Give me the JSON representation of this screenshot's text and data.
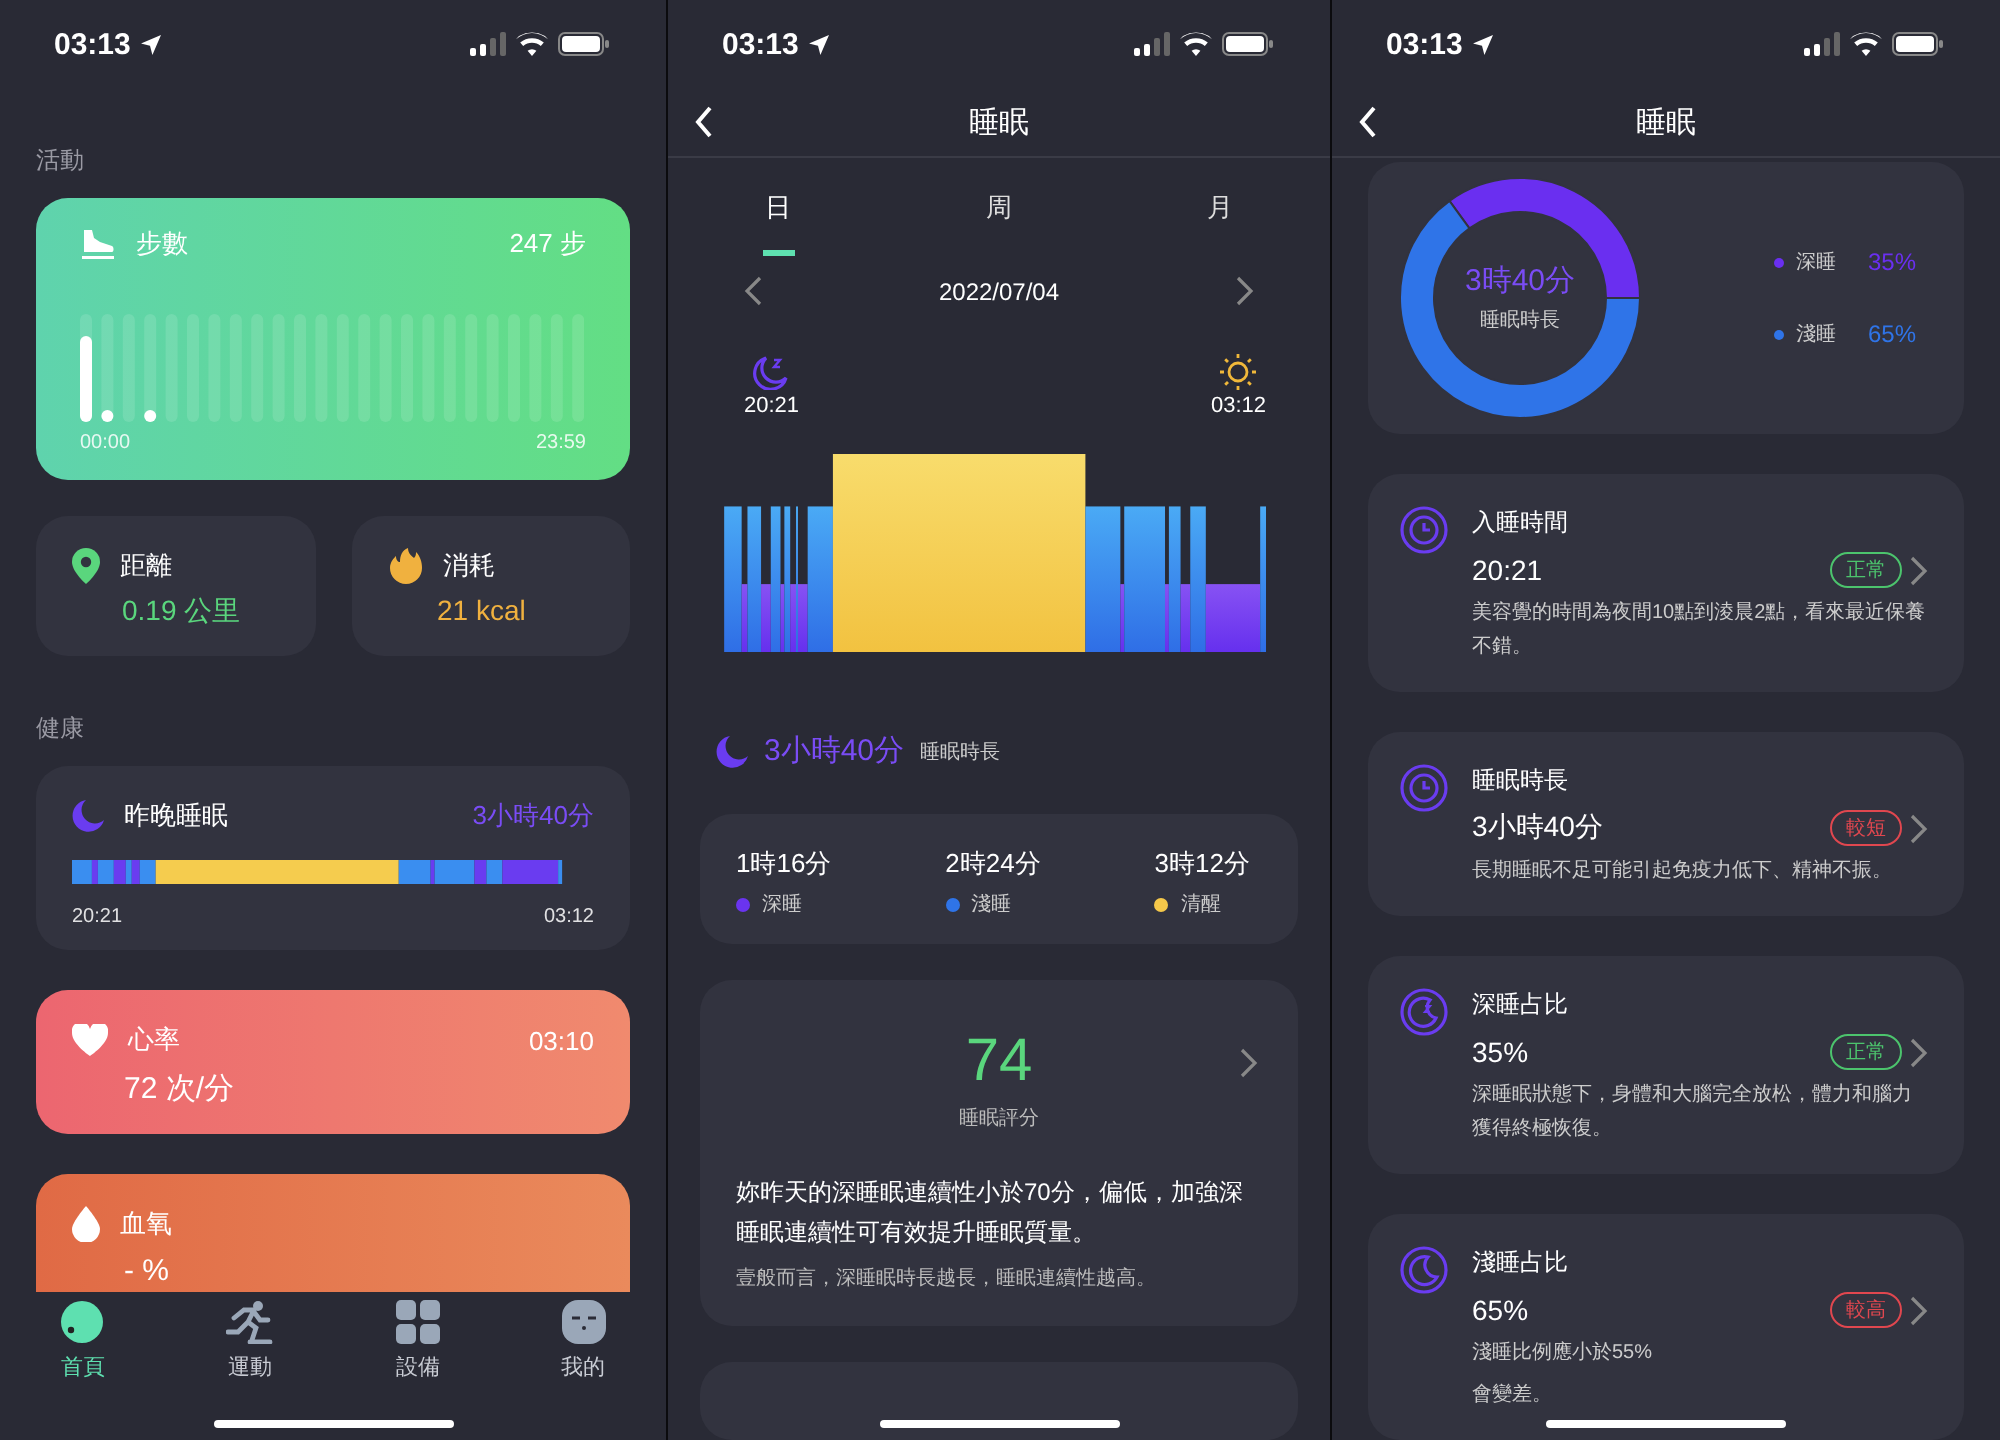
{
  "home": {
    "status_time": "03:13",
    "section_activity": "活動",
    "steps": {
      "label": "步數",
      "value": "247 步",
      "start": "00:00",
      "end": "23:59"
    },
    "stats": [
      {
        "kind": "distance",
        "label": "距離",
        "value": "0.19 公里"
      },
      {
        "kind": "calories",
        "label": "消耗",
        "value": "21 kcal"
      }
    ],
    "section_health": "健康",
    "sleep": {
      "label": "昨晚睡眠",
      "value": "3小時40分",
      "start": "20:21",
      "end": "03:12"
    },
    "vitals": [
      {
        "kind": "heart",
        "label": "心率",
        "value": "72 次/分",
        "time": "03:10"
      },
      {
        "kind": "oxygen",
        "label": "血氧",
        "value": "- %"
      }
    ],
    "tab_bar": [
      {
        "kind": "home",
        "label": "首頁",
        "selected": true
      },
      {
        "kind": "workout",
        "label": "運動",
        "selected": false
      },
      {
        "kind": "devices",
        "label": "設備",
        "selected": false
      },
      {
        "kind": "profile",
        "label": "我的",
        "selected": false
      }
    ]
  },
  "sleep_day": {
    "status_time": "03:13",
    "title": "睡眠",
    "tabs": [
      {
        "label": "日",
        "selected": true
      },
      {
        "label": "周",
        "selected": false
      },
      {
        "label": "月",
        "selected": false
      }
    ],
    "date": "2022/07/04",
    "sleep_time": "20:21",
    "wake_time": "03:12",
    "total": "3小時40分",
    "total_label": "睡眠時長",
    "stages": [
      {
        "value": "1時16分",
        "label": "深睡",
        "color": "#6a34f0"
      },
      {
        "value": "2時24分",
        "label": "淺睡",
        "color": "#2f74e8"
      },
      {
        "value": "3時12分",
        "label": "清醒",
        "color": "#f5c84a"
      }
    ],
    "score": {
      "value": "74",
      "label": "睡眠評分",
      "text": "妳昨天的深睡眠連續性小於70分，偏低，加強深睡眠連續性可有效提升睡眠質量。",
      "note": "壹般而言，深睡眠時長越長，睡眠連續性越高。"
    }
  },
  "sleep_detail": {
    "status_time": "03:13",
    "title": "睡眠",
    "center_value": "3時40分",
    "center_label": "睡眠時長",
    "chart_data": {
      "type": "donut",
      "categories": [
        "深睡",
        "淺睡"
      ],
      "values": [
        35,
        65
      ],
      "value_labels": [
        "35%",
        "65%"
      ],
      "colors": [
        "#6a2ff0",
        "#2f74e8"
      ]
    },
    "cards": [
      {
        "kind": "clock",
        "title": "入睡時間",
        "value": "20:21",
        "status": "正常",
        "color": "#4cc46d",
        "description": [
          "美容覺的時間為夜間10點到淩晨2點，看來最近保養不錯。"
        ]
      },
      {
        "kind": "clock",
        "title": "睡眠時長",
        "value": "3小時40分",
        "status": "較短",
        "color": "#e0474f",
        "description": [
          "長期睡眠不足可能引起免疫力低下、精神不振。"
        ]
      },
      {
        "kind": "moon_z",
        "title": "深睡占比",
        "value": "35%",
        "status": "正常",
        "color": "#4cc46d",
        "description": [
          "深睡眠狀態下，身體和大腦完全放松，體力和腦力獲得終極恢復。"
        ]
      },
      {
        "kind": "moon",
        "title": "淺睡占比",
        "value": "65%",
        "status": "較高",
        "color": "#e0474f",
        "description": [
          "淺睡比例應小於55%",
          "會變差。"
        ]
      }
    ]
  }
}
